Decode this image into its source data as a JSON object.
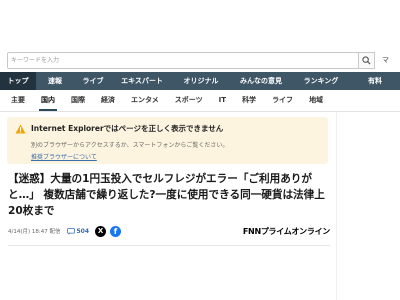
{
  "search": {
    "placeholder": "キーワードを入力",
    "more_label": "マ"
  },
  "main_nav": [
    {
      "label": "トップ",
      "active": true
    },
    {
      "label": "速報",
      "active": false
    },
    {
      "label": "ライブ",
      "active": false
    },
    {
      "label": "エキスパート",
      "active": false
    },
    {
      "label": "オリジナル",
      "active": false
    },
    {
      "label": "みんなの意見",
      "active": false
    },
    {
      "label": "ランキング",
      "active": false
    },
    {
      "label": "有料",
      "active": false
    }
  ],
  "sub_nav": [
    {
      "label": "主要",
      "active": false
    },
    {
      "label": "国内",
      "active": true
    },
    {
      "label": "国際",
      "active": false
    },
    {
      "label": "経済",
      "active": false
    },
    {
      "label": "エンタメ",
      "active": false
    },
    {
      "label": "スポーツ",
      "active": false
    },
    {
      "label": "IT",
      "active": false
    },
    {
      "label": "科学",
      "active": false
    },
    {
      "label": "ライフ",
      "active": false
    },
    {
      "label": "地域",
      "active": false
    }
  ],
  "alert": {
    "title": "Internet Explorerではページを正しく表示できません",
    "message": "別のブラウザーからアクセスするか、スマートフォンからご覧ください。",
    "link": "推奨ブラウザーについて"
  },
  "article": {
    "headline": "【迷惑】大量の1円玉投入でセルフレジがエラー「ご利用ありがと…」 複数店舗で繰り返した?一度に使用できる同一硬貨は法律上20枚まで",
    "date": "4/14(月) 18:47 配信",
    "comment_count": "504",
    "source": "FNNプライムオンライン"
  },
  "colors": {
    "nav_bg": "#3f5667",
    "nav_active": "#22323e",
    "alert_bg": "#fdf4e0",
    "warn": "#f0a500",
    "link": "#3c6ea8",
    "facebook": "#1877f2"
  }
}
